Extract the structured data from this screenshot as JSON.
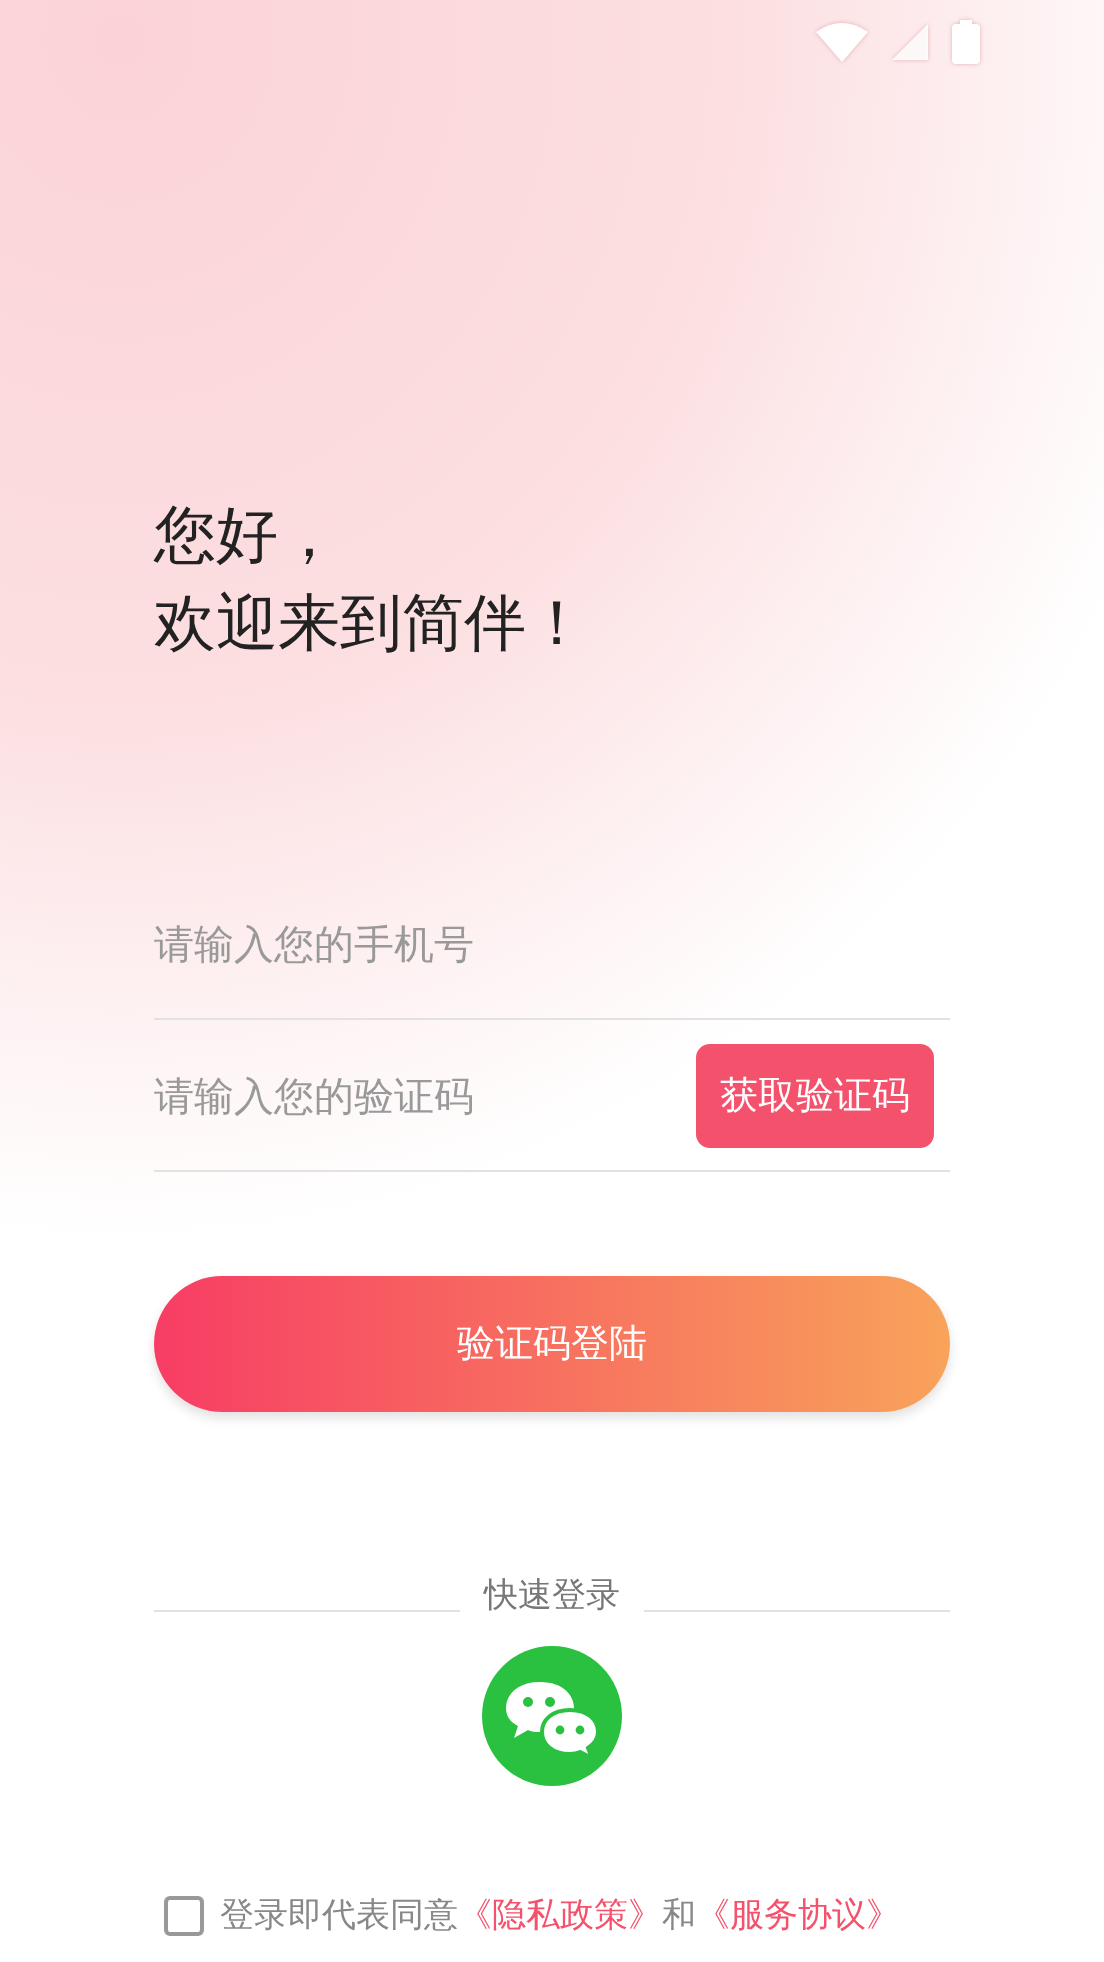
{
  "greeting": [
    "您好，",
    "欢迎来到简伴！"
  ],
  "phone_field": {
    "placeholder": "请输入您的手机号"
  },
  "code_field": {
    "placeholder": "请输入您的验证码"
  },
  "get_code_button": "获取验证码",
  "login_button": "验证码登陆",
  "quick_login": {
    "label": "快速登录"
  },
  "agreement": {
    "checked": false,
    "parts": [
      {
        "kind": "plain",
        "text": "登录即代表同意"
      },
      {
        "kind": "link",
        "text": "《隐私政策》"
      },
      {
        "kind": "plain",
        "text": "和"
      },
      {
        "kind": "link",
        "text": "《服务协议》"
      }
    ]
  }
}
